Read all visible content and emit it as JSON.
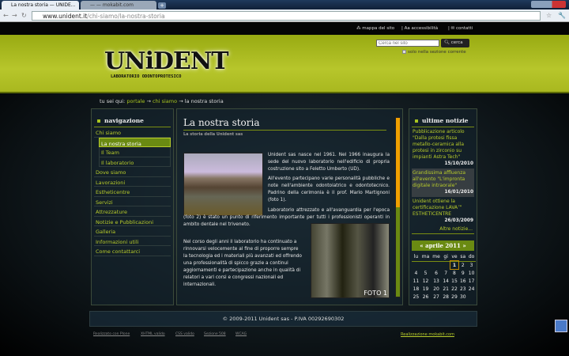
{
  "browser": {
    "tabs": [
      {
        "title": "La nostra storia — UNIDE...",
        "active": true
      },
      {
        "title": "— — mokabit.com",
        "active": false
      }
    ],
    "new_tab": "+",
    "url_host": "www.unident.it",
    "url_path": "/chi-siamo/la-nostra-storia"
  },
  "topbar": {
    "links": [
      "mappa del sito",
      "accessibilità",
      "contatti"
    ]
  },
  "header": {
    "logo": "UNiDENT",
    "logo_sub": "LABORATORIO ODONTOPROTESICO",
    "search_placeholder": "Cerca nel sito",
    "search_button": "cerca",
    "only_section": "solo nella sezione corrente"
  },
  "breadcrumb": {
    "label": "tu sei qui:",
    "items": [
      "portale",
      "chi siamo"
    ],
    "current": "la nostra storia",
    "sep": "→"
  },
  "nav": {
    "title": "navigazione",
    "items": [
      {
        "label": "Chi siamo"
      },
      {
        "label": "La nostra storia",
        "sub": true,
        "active": true
      },
      {
        "label": "Il Team",
        "sub": true
      },
      {
        "label": "Il laboratorio",
        "sub": true
      },
      {
        "label": "Dove siamo"
      },
      {
        "label": "Lavorazioni"
      },
      {
        "label": "Estheticentre"
      },
      {
        "label": "Servizi"
      },
      {
        "label": "Attrezzature"
      },
      {
        "label": "Notizie e Pubblicazioni"
      },
      {
        "label": "Galleria"
      },
      {
        "label": "Informazioni utili"
      },
      {
        "label": "Come contattarci"
      }
    ]
  },
  "content": {
    "title": "La nostra storia",
    "subtitle": "La storia della Unident sas",
    "photo_label": "FOTO 1",
    "paragraphs": [
      "Unident sas nasce nel 1961. Nel 1966 inaugura la sede del nuovo laboratorio nell'edificio di propria costruzione sito a Feletto Umberto (UD).",
      "All'evento partecipano varie personalità pubbliche e note nell'ambiente odontoiatrico e odontotecnico. Padrino della cerimonia è il prof. Mario Martignoni (foto 1).",
      "Laboratorio attrezzato e all'avanguardia per l'epoca (foto 2) è stato un punto di riferimento importante per tutti i professionisti operanti in ambito dentale nel triveneto.",
      "Nel corso degli anni il laboratorio ha continuato a rinnovarsi velocemente al fine di proporre sempre la tecnologia ed i materiali più avanzati ed offrendo una professionalità di spicco grazie a continui aggiornamenti e partecipazione anche in qualità di relatori a vari corsi e congressi nazionali ed internazionali."
    ]
  },
  "news": {
    "title": "ultime notizie",
    "items": [
      {
        "text": "Pubblicazione articolo \"Dalla protesi fissa metallo-ceramica alla protesi in zirconio su impianti Astra Tech\"",
        "date": "15/10/2010"
      },
      {
        "text": "Grandissima affluenza all'evento \"L'impronta digitale intraorale\"",
        "date": "16/01/2010"
      },
      {
        "text": "Unident ottiene la certificazione LAVA™ ESTHETICENTRE",
        "date": "26/03/2009"
      }
    ],
    "more": "Altre notizie..."
  },
  "calendar": {
    "title": "« aprile 2011 »",
    "days": [
      "lu",
      "ma",
      "me",
      "gi",
      "ve",
      "sa",
      "do"
    ],
    "weeks": [
      [
        "",
        "",
        "",
        "",
        "1",
        "2",
        "3"
      ],
      [
        "4",
        "5",
        "6",
        "7",
        "8",
        "9",
        "10"
      ],
      [
        "11",
        "12",
        "13",
        "14",
        "15",
        "16",
        "17"
      ],
      [
        "18",
        "19",
        "20",
        "21",
        "22",
        "23",
        "24"
      ],
      [
        "25",
        "26",
        "27",
        "28",
        "29",
        "30",
        ""
      ]
    ],
    "today": "1"
  },
  "footer": {
    "copyright": "© 2009-2011 Unident sas - P.IVA 00292690302",
    "links": [
      "Realizzato con Plone",
      "XHTML valido",
      "CSS valido",
      "Sezione 508",
      "WCAG"
    ],
    "credit": "Realizzazione mokabit.com"
  },
  "colors": {
    "accent": "#b8cc2a",
    "header": "#a9b81f",
    "active_nav": "#6a8a12"
  }
}
